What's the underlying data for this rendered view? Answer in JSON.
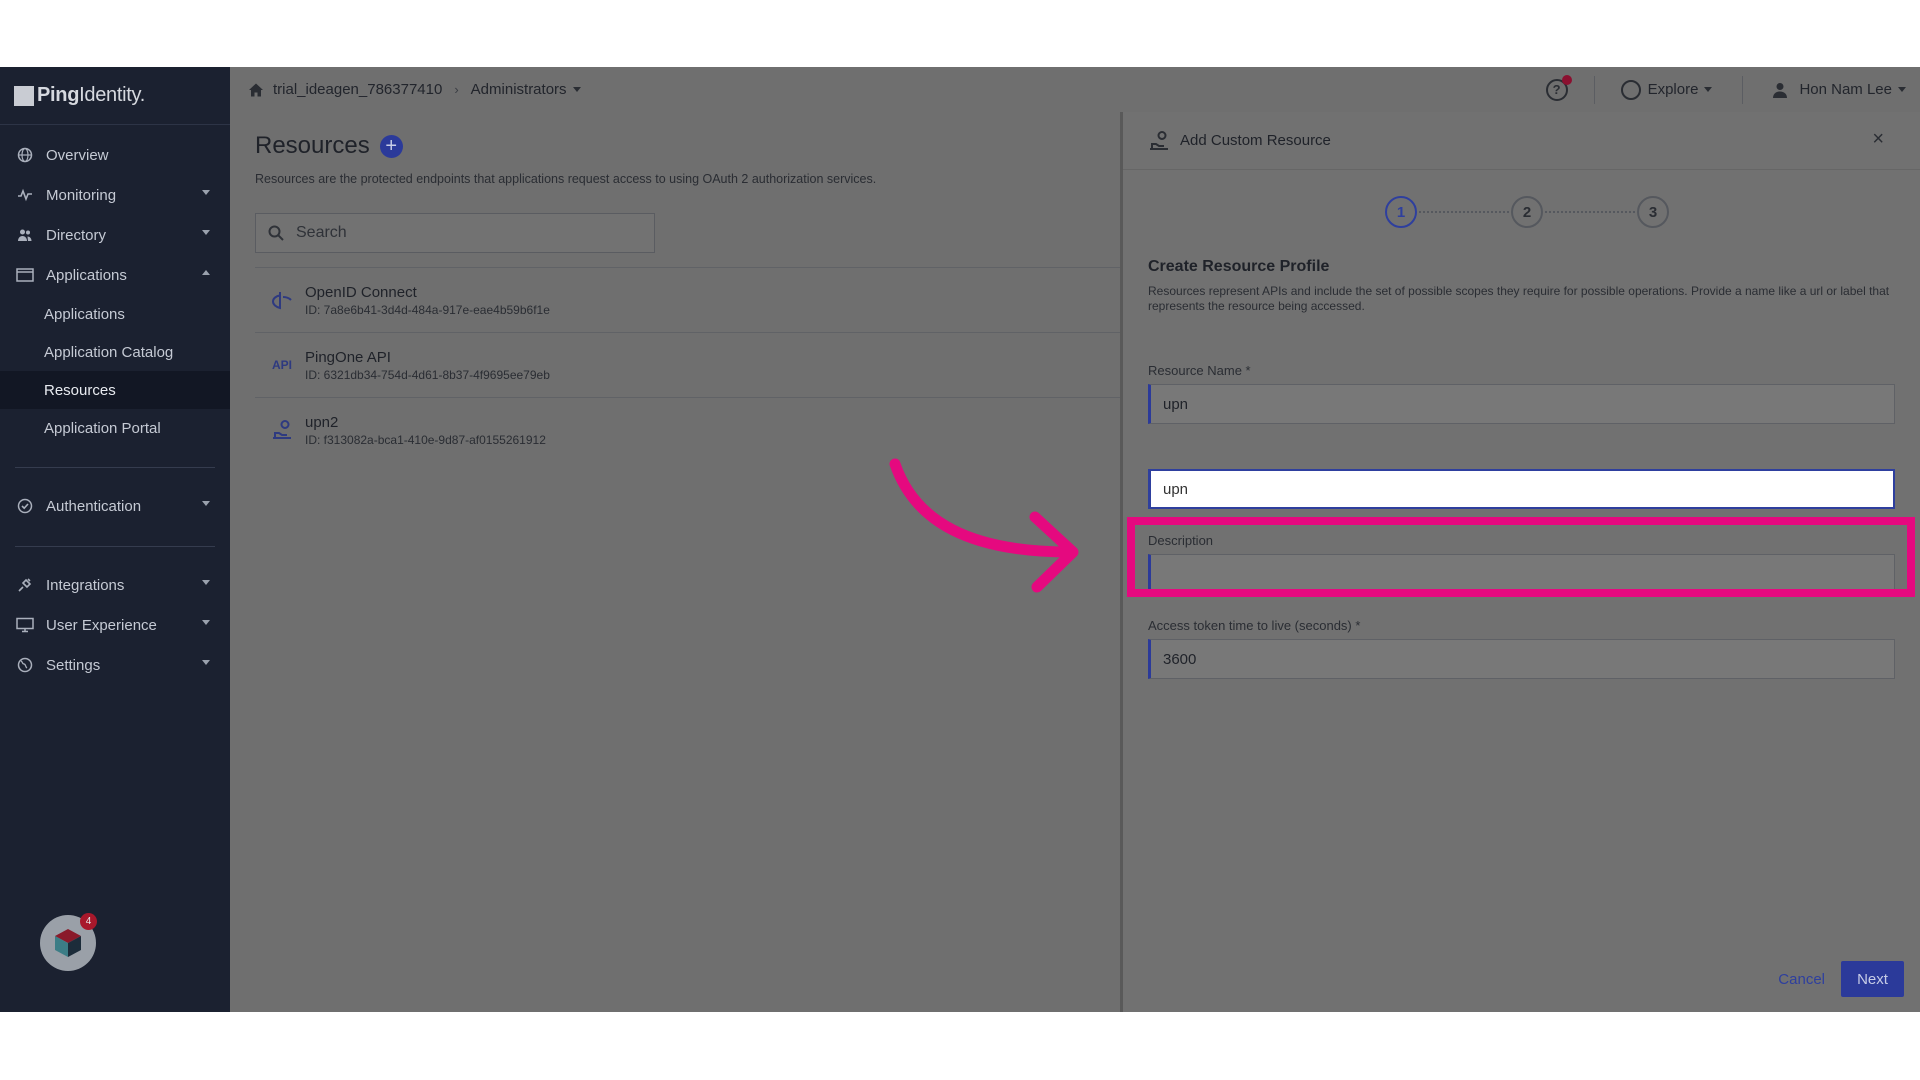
{
  "brand": {
    "logo_strong": "Ping",
    "logo_light": "Identity."
  },
  "topbar": {
    "environment": "trial_ideagen_786377410",
    "separator": "›",
    "role": "Administrators",
    "explore": "Explore",
    "user": "Hon Nam Lee"
  },
  "sidebar": {
    "items": [
      {
        "label": "Overview",
        "icon": "globe-icon"
      },
      {
        "label": "Monitoring",
        "icon": "pulse-icon"
      },
      {
        "label": "Directory",
        "icon": "users-icon"
      },
      {
        "label": "Applications",
        "icon": "window-icon"
      }
    ],
    "sub_items": [
      {
        "label": "Applications"
      },
      {
        "label": "Application Catalog"
      },
      {
        "label": "Resources",
        "active": true
      },
      {
        "label": "Application Portal"
      }
    ],
    "items_b": [
      {
        "label": "Authentication",
        "icon": "check-circle-icon"
      }
    ],
    "items_c": [
      {
        "label": "Integrations",
        "icon": "plug-icon"
      },
      {
        "label": "User Experience",
        "icon": "monitor-icon"
      },
      {
        "label": "Settings",
        "icon": "globe-settings-icon"
      }
    ],
    "badge_count": "4"
  },
  "main": {
    "title": "Resources",
    "add_label": "+",
    "description": "Resources are the protected endpoints that applications request access to using OAuth 2 authorization services.",
    "search_placeholder": "Search",
    "resources": [
      {
        "name": "OpenID Connect",
        "id": "ID: 7a8e6b41-3d4d-484a-917e-eae4b59b6f1e",
        "icon": "openid-icon"
      },
      {
        "name": "PingOne API",
        "id": "ID: 6321db34-754d-4d61-8b37-4f9695ee79eb",
        "icon": "api-icon"
      },
      {
        "name": "upn2",
        "id": "ID: f313082a-bca1-410e-9d87-af0155261912",
        "icon": "custom-resource-icon"
      }
    ]
  },
  "panel": {
    "title": "Add Custom Resource",
    "close": "×",
    "steps": [
      "1",
      "2",
      "3"
    ],
    "form_title": "Create Resource Profile",
    "form_description": "Resources represent APIs and include the set of possible scopes they require for possible operations. Provide a name like a url or label that represents the resource being accessed.",
    "fields": {
      "resource_name": {
        "label": "Resource Name *",
        "value": "upn"
      },
      "audience": {
        "value": "upn"
      },
      "description": {
        "label": "Description",
        "value": ""
      },
      "ttl": {
        "label": "Access token time to live (seconds) *",
        "value": "3600"
      }
    },
    "cancel": "Cancel",
    "next": "Next"
  },
  "colors": {
    "accent": "#2b3a9a",
    "highlight": "#e5097f",
    "sidebar": "#1b2130"
  }
}
